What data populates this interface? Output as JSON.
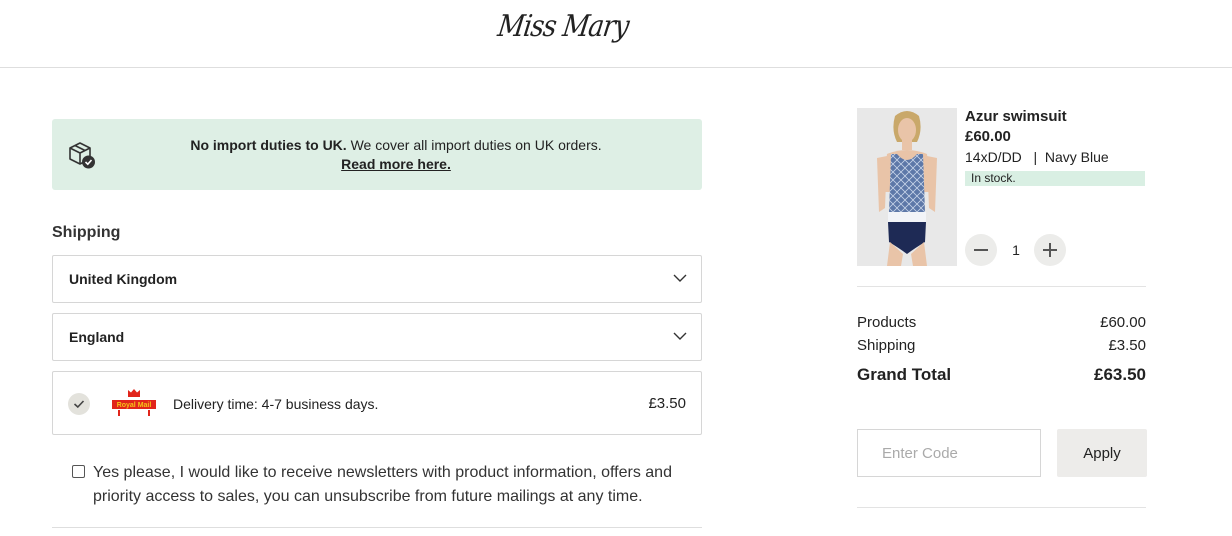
{
  "brand": {
    "logo_text": "Miss Mary"
  },
  "banner": {
    "bold_text": "No import duties to UK.",
    "text": " We cover all import duties on UK orders.",
    "link": "Read more here."
  },
  "shipping": {
    "title": "Shipping",
    "country": "United Kingdom",
    "region": "England",
    "delivery": {
      "carrier_logo_text": "Royal Mail",
      "time": "Delivery time: 4-7 business days.",
      "price": "£3.50"
    }
  },
  "newsletter": {
    "label": "Yes please, I would like to receive newsletters with product information, offers and priority access to sales, you can unsubscribe from future mailings at any time."
  },
  "product": {
    "name": "Azur swimsuit",
    "price": "£60.00",
    "size": "14xD/DD",
    "color": "Navy Blue",
    "stock": "In stock.",
    "quantity": "1"
  },
  "summary": {
    "products_label": "Products",
    "products_amount": "£60.00",
    "shipping_label": "Shipping",
    "shipping_amount": "£3.50",
    "total_label": "Grand Total",
    "total_amount": "£63.50"
  },
  "discount": {
    "placeholder": "Enter Code",
    "apply_label": "Apply"
  },
  "colors": {
    "banner_bg": "#deefe5",
    "stock_bg": "#d9efe3",
    "button_bg": "#edecea",
    "royal_mail_red": "#e1251b",
    "royal_mail_gold": "#f5c518"
  }
}
